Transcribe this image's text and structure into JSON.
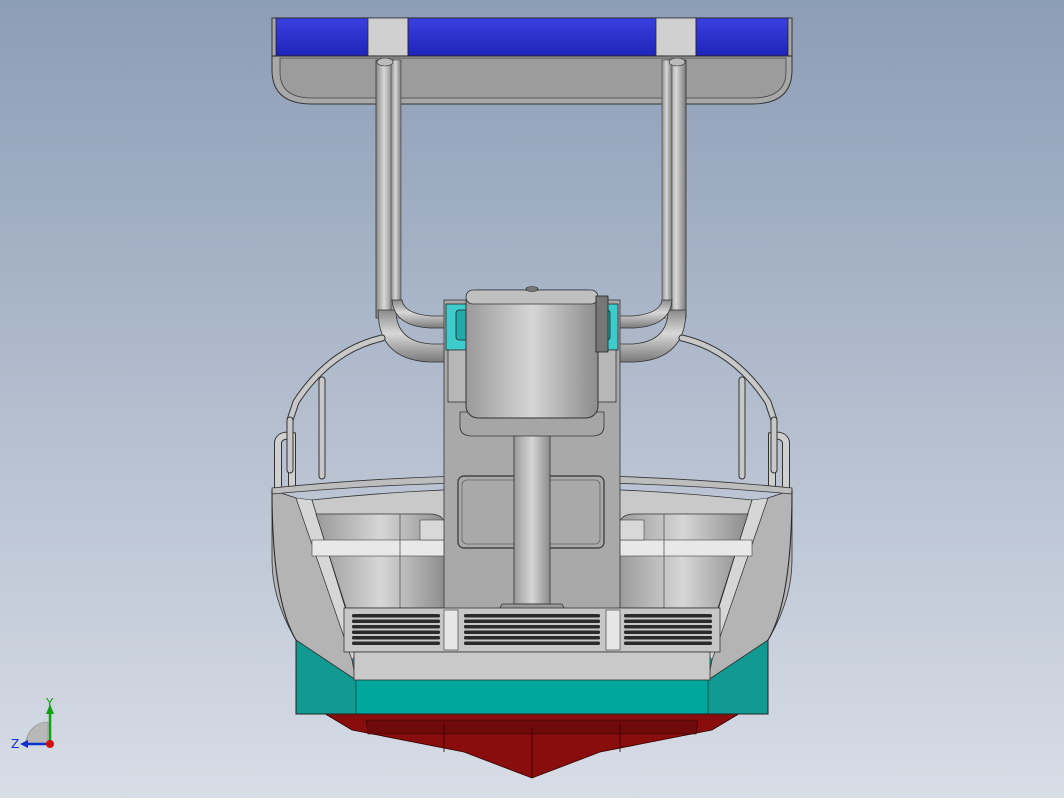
{
  "viewport": {
    "background_top": "#8c9db6",
    "background_bottom": "#d8dde6",
    "model": {
      "canopy_color": "#2a2fcc",
      "hull_waterline_color": "#00a79d",
      "hull_bottom_color": "#8a0d0d",
      "body_color": "#c4c4c4",
      "console_screen_color": "#3ecbcb",
      "edge_color": "#222222"
    }
  },
  "triad": {
    "x_axis_color": "#d01010",
    "y_axis_color": "#10a010",
    "z_axis_color": "#1030d0",
    "y_label": "Y",
    "z_label": "Z"
  }
}
